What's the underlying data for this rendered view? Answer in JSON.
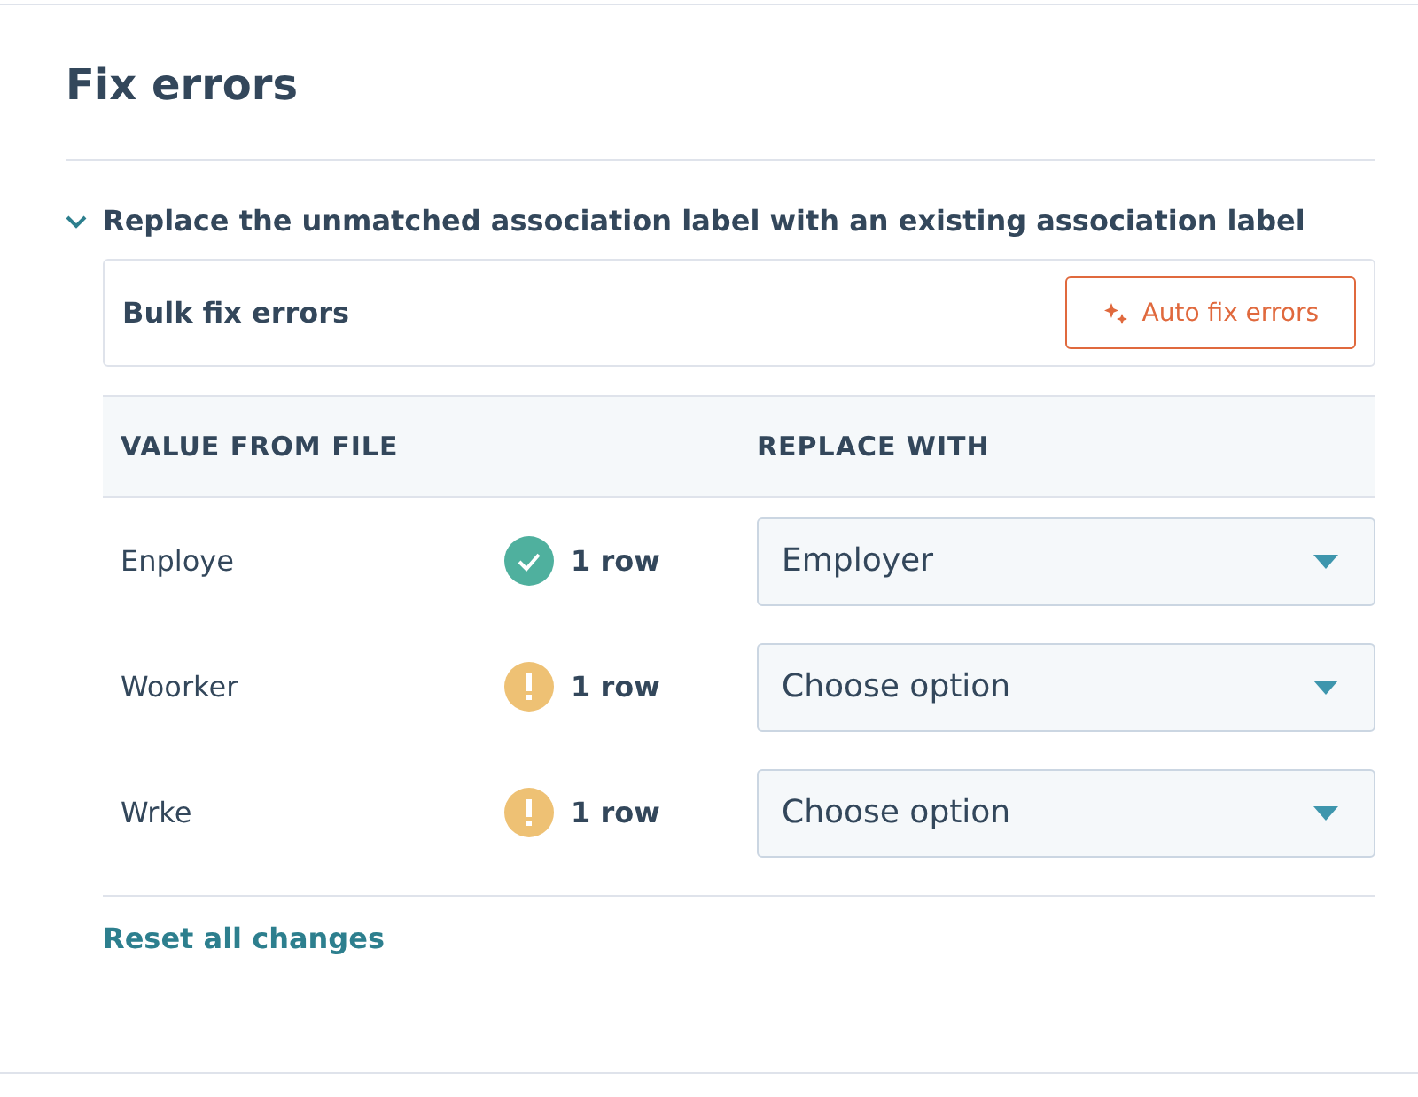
{
  "title": "Fix errors",
  "section": {
    "heading": "Replace the unmatched association label with an existing association label",
    "expanded": true,
    "bulk": {
      "label": "Bulk fix errors",
      "button": "Auto fix errors"
    },
    "table": {
      "columns": [
        "VALUE FROM FILE",
        "REPLACE WITH"
      ],
      "rows": [
        {
          "value": "Enploye",
          "kind": "ok",
          "count": "1 row",
          "replacement": "Employer"
        },
        {
          "value": "Woorker",
          "kind": "warning",
          "count": "1 row",
          "replacement": "Choose option"
        },
        {
          "value": "Wrke",
          "kind": "warning",
          "count": "1 row",
          "replacement": "Choose option"
        }
      ]
    },
    "reset": "Reset all changes"
  }
}
